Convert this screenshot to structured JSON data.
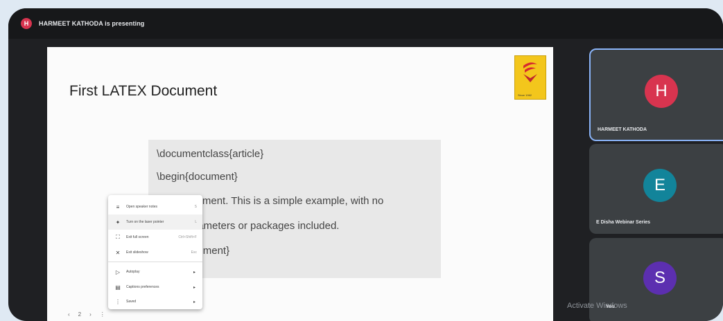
{
  "topbar": {
    "presenter_initial": "H",
    "presenting_text": "HARMEET KATHODA is presenting"
  },
  "slide": {
    "title": "First LATEX Document",
    "logo_caption": "Since 1962",
    "code_lines": [
      "\\documentclass{article}",
      "\\begin{document}",
      "First document. This is a simple example, with no",
      "extra parameters or packages included.",
      "\\end{document}"
    ]
  },
  "context_menu": {
    "items": [
      {
        "label": "Open speaker notes",
        "hint": "S"
      },
      {
        "label": "Turn on the laser pointer",
        "hint": "L"
      },
      {
        "label": "Exit full screen",
        "hint": "Ctrl+Shift+F"
      },
      {
        "label": "Exit slideshow",
        "hint": "Esc"
      },
      {
        "label": "Autoplay"
      },
      {
        "label": "Captions preferences"
      },
      {
        "label": "Saved"
      }
    ]
  },
  "slide_nav": {
    "prev": "‹",
    "page": "2",
    "next": "›",
    "more": "⋮"
  },
  "participants": [
    {
      "initial": "H",
      "name": "HARMEET KATHODA",
      "color": "#d8344f"
    },
    {
      "initial": "E",
      "name": "E Disha Webinar Series",
      "color": "#12849a"
    },
    {
      "initial": "S",
      "name": "You",
      "color": "#5c2fb0"
    }
  ],
  "watermark": "Activate Windows"
}
